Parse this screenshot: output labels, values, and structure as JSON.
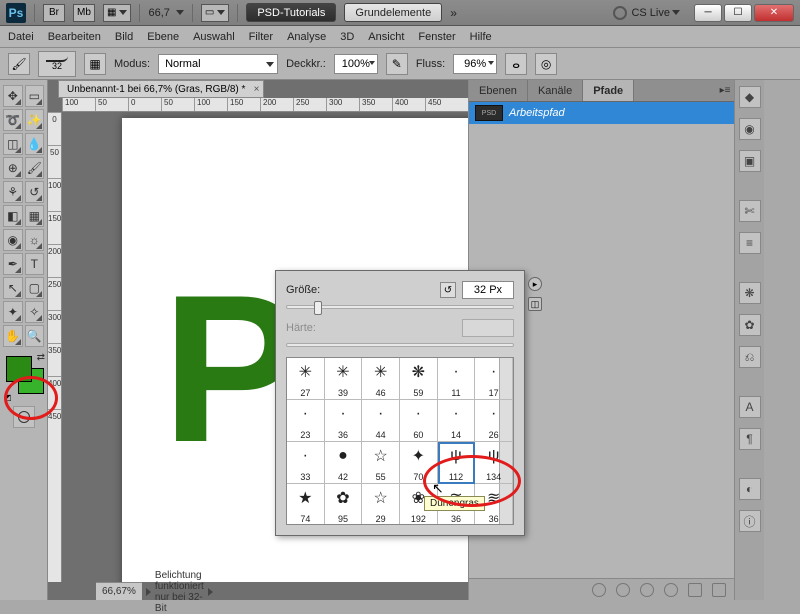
{
  "app": {
    "icon_label": "Ps"
  },
  "titlebar": {
    "box_br": "Br",
    "box_mb": "Mb",
    "zoom": "66,7",
    "btn_tutorials": "PSD-Tutorials",
    "btn_basics": "Grundelemente",
    "cslive": "CS Live"
  },
  "menu": [
    "Datei",
    "Bearbeiten",
    "Bild",
    "Ebene",
    "Auswahl",
    "Filter",
    "Analyse",
    "3D",
    "Ansicht",
    "Fenster",
    "Hilfe"
  ],
  "options": {
    "brush_size_small": "32",
    "modus_label": "Modus:",
    "modus_value": "Normal",
    "opacity_label": "Deckkr.:",
    "opacity_value": "100%",
    "flow_label": "Fluss:",
    "flow_value": "96%"
  },
  "document": {
    "tab_title": "Unbenannt-1 bei 66,7% (Gras, RGB/8) *",
    "ruler_h": [
      "100",
      "50",
      "0",
      "50",
      "100",
      "150",
      "200",
      "250",
      "300",
      "350",
      "400",
      "450"
    ],
    "ruler_v": [
      "0",
      "50",
      "100",
      "150",
      "200",
      "250",
      "300",
      "350",
      "400",
      "450"
    ],
    "text_content": "PS"
  },
  "colors": {
    "fg": "#2a8a14",
    "bg": "#36b32a"
  },
  "status": {
    "zoom": "66,67%",
    "msg": "Belichtung funktioniert nur bei 32-Bit"
  },
  "paths_panel": {
    "tabs": [
      "Ebenen",
      "Kanäle",
      "Pfade"
    ],
    "active_tab": 2,
    "item": "Arbeitspfad"
  },
  "brush_popup": {
    "size_label": "Größe:",
    "size_value": "32 Px",
    "hardness_label": "Härte:",
    "slider_pos_pct": 12,
    "tooltip": "Dünengras",
    "presets": [
      {
        "n": "27",
        "g": "✳"
      },
      {
        "n": "39",
        "g": "✳"
      },
      {
        "n": "46",
        "g": "✳"
      },
      {
        "n": "59",
        "g": "❋"
      },
      {
        "n": "11",
        "g": "·"
      },
      {
        "n": "17",
        "g": "·"
      },
      {
        "n": "23",
        "g": "·"
      },
      {
        "n": "36",
        "g": "·"
      },
      {
        "n": "44",
        "g": "·"
      },
      {
        "n": "60",
        "g": "·"
      },
      {
        "n": "14",
        "g": "·"
      },
      {
        "n": "26",
        "g": "·"
      },
      {
        "n": "33",
        "g": "·"
      },
      {
        "n": "42",
        "g": "●"
      },
      {
        "n": "55",
        "g": "☆"
      },
      {
        "n": "70",
        "g": "✦"
      },
      {
        "n": "112",
        "g": "ψ",
        "sel": true
      },
      {
        "n": "134",
        "g": "ψ"
      },
      {
        "n": "74",
        "g": "★"
      },
      {
        "n": "95",
        "g": "✿"
      },
      {
        "n": "29",
        "g": "☆"
      },
      {
        "n": "192",
        "g": "❀"
      },
      {
        "n": "36",
        "g": "≋"
      },
      {
        "n": "36",
        "g": "≋"
      }
    ]
  }
}
